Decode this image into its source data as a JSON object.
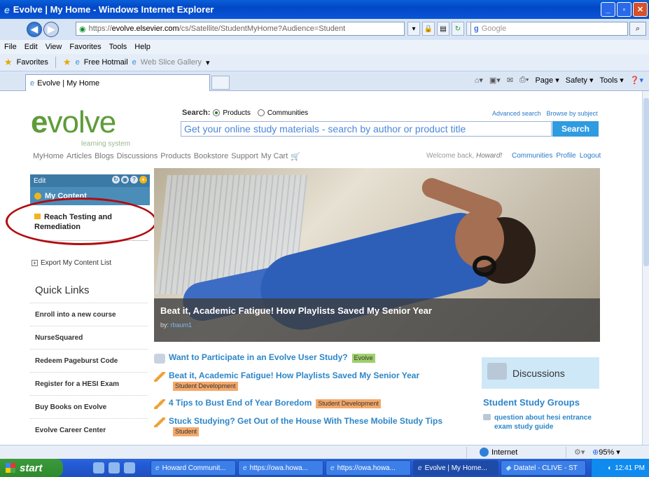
{
  "window": {
    "title": "Evolve | My Home - Windows Internet Explorer",
    "url_scheme": "https://",
    "url_domain": "evolve.elsevier.com",
    "url_path": "/cs/Satellite/StudentMyHome?Audience=Student",
    "search_placeholder": "Google"
  },
  "menu": [
    "File",
    "Edit",
    "View",
    "Favorites",
    "Tools",
    "Help"
  ],
  "favorites": {
    "label": "Favorites",
    "items": [
      "Free Hotmail",
      "Web Slice Gallery"
    ]
  },
  "tab": {
    "title": "Evolve | My Home"
  },
  "commandbar": [
    "Page",
    "Safety",
    "Tools"
  ],
  "site": {
    "logo": "volve",
    "logo_e": "e",
    "logo_sub": "learning system",
    "search_label": "Search:",
    "radio_products": "Products",
    "radio_communities": "Communities",
    "advanced_search": "Advanced search",
    "browse_subject": "Browse by subject",
    "search_placeholder": "Get your online study materials - search by author or product title",
    "search_button": "Search",
    "nav": [
      "MyHome",
      "Articles",
      "Blogs",
      "Discussions",
      "Products",
      "Bookstore",
      "Support",
      "My Cart"
    ],
    "welcome_text": "Welcome back,",
    "welcome_name": "Howard!",
    "user_links": [
      "Communities",
      "Profile",
      "Logout"
    ]
  },
  "sidebar": {
    "edit": "Edit",
    "my_content": "My Content",
    "reach_item": "Reach Testing and Remediation",
    "export": "Export My Content List",
    "quick_links_title": "Quick Links",
    "quick_links": [
      "Enroll into a new course",
      "NurseSquared",
      "Redeem Pageburst Code",
      "Register for a HESI Exam",
      "Buy Books on Evolve",
      "Evolve Career Center"
    ]
  },
  "hero": {
    "title": "Beat it, Academic Fatigue! How Playlists Saved My Senior Year",
    "by_label": "by:",
    "author": "rbaum1"
  },
  "articles": [
    {
      "title": "Want to Participate in an Evolve User Study?",
      "tag": "Evolve",
      "tag_color": "#9fd06b",
      "icon": "speech-bubble-icon"
    },
    {
      "title": "Beat it, Academic Fatigue! How Playlists Saved My Senior Year",
      "tag": "Student Development",
      "tag_color": "#f3a86a",
      "icon": "pencil-icon"
    },
    {
      "title": "4 Tips to Bust End of Year Boredom",
      "tag": "Student Development",
      "tag_color": "#f3a86a",
      "icon": "pencil-icon"
    },
    {
      "title": "Stuck Studying? Get Out of the House With These Mobile Study Tips",
      "tag": "Student",
      "tag_color": "#f3a86a",
      "icon": "pencil-icon"
    }
  ],
  "discussions": {
    "title": "Discussions",
    "group_title": "Student Study Groups",
    "question": "question about hesi entrance exam study guide"
  },
  "status": {
    "zone": "Internet",
    "zoom": "95%"
  },
  "taskbar": {
    "start": "start",
    "buttons": [
      "Howard Communit...",
      "https://owa.howa...",
      "https://owa.howa...",
      "Evolve | My Home...",
      "Datatel - CLIVE - ST"
    ],
    "clock": "12:41 PM"
  },
  "colors": {
    "brand_green": "#5e9c3a",
    "link_blue": "#2d86c8",
    "annotation_red": "#b10c10"
  }
}
